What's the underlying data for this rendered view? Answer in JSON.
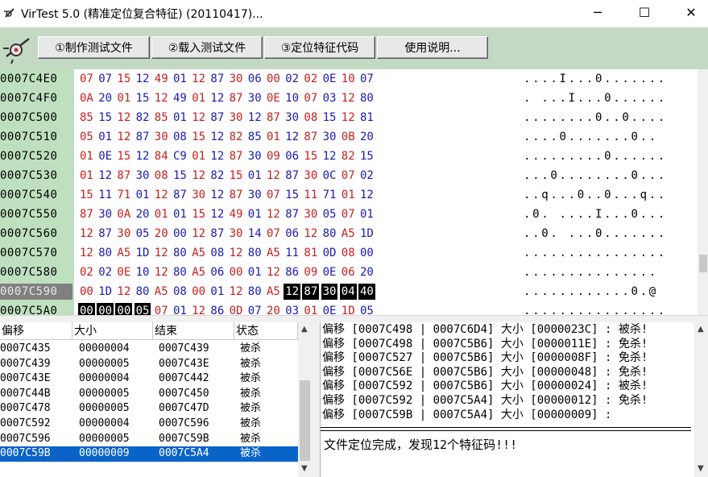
{
  "window": {
    "title": "VirTest 5.0 (精准定位复合特征) (20110417)...",
    "minimize_glyph": "─",
    "maximize_glyph": "☐",
    "close_glyph": "✕",
    "icon": "app-icon"
  },
  "toolbar": {
    "icon": "tool-icon",
    "buttons": [
      {
        "label": "①制作测试文件"
      },
      {
        "label": "②载入测试文件"
      },
      {
        "label": "③定位特征代码"
      },
      {
        "label": "使用说明..."
      }
    ]
  },
  "hex": {
    "rows": [
      {
        "addr": "0007C4E0",
        "bytes": [
          "07",
          "07",
          "15",
          "12",
          "49",
          "01",
          "12",
          "87",
          "30",
          "06",
          "00",
          "02",
          "02",
          "0E",
          "10",
          "07"
        ],
        "ascii": "....I...0......."
      },
      {
        "addr": "0007C4F0",
        "bytes": [
          "0A",
          "20",
          "01",
          "15",
          "12",
          "49",
          "01",
          "12",
          "87",
          "30",
          "0E",
          "10",
          "07",
          "03",
          "12",
          "80"
        ],
        "ascii": ". ...I...0......"
      },
      {
        "addr": "0007C500",
        "bytes": [
          "85",
          "15",
          "12",
          "82",
          "85",
          "01",
          "12",
          "87",
          "30",
          "12",
          "87",
          "30",
          "08",
          "15",
          "12",
          "81"
        ],
        "ascii": "........0..0...."
      },
      {
        "addr": "0007C510",
        "bytes": [
          "05",
          "01",
          "12",
          "87",
          "30",
          "08",
          "15",
          "12",
          "82",
          "85",
          "01",
          "12",
          "87",
          "30",
          "0B",
          "20"
        ],
        "ascii": "....0.......0.. "
      },
      {
        "addr": "0007C520",
        "bytes": [
          "01",
          "0E",
          "15",
          "12",
          "84",
          "C9",
          "01",
          "12",
          "87",
          "30",
          "09",
          "06",
          "15",
          "12",
          "82",
          "15"
        ],
        "ascii": ".........0......"
      },
      {
        "addr": "0007C530",
        "bytes": [
          "01",
          "12",
          "87",
          "30",
          "08",
          "15",
          "12",
          "82",
          "15",
          "01",
          "12",
          "87",
          "30",
          "0C",
          "07",
          "02"
        ],
        "ascii": "...0........0..."
      },
      {
        "addr": "0007C540",
        "bytes": [
          "15",
          "11",
          "71",
          "01",
          "12",
          "87",
          "30",
          "12",
          "87",
          "30",
          "07",
          "15",
          "11",
          "71",
          "01",
          "12"
        ],
        "ascii": "..q...0..0...q.."
      },
      {
        "addr": "0007C550",
        "bytes": [
          "87",
          "30",
          "0A",
          "20",
          "01",
          "01",
          "15",
          "12",
          "49",
          "01",
          "12",
          "87",
          "30",
          "05",
          "07",
          "01"
        ],
        "ascii": ".0. ....I...0..."
      },
      {
        "addr": "0007C560",
        "bytes": [
          "12",
          "87",
          "30",
          "05",
          "20",
          "00",
          "12",
          "87",
          "30",
          "14",
          "07",
          "06",
          "12",
          "80",
          "A5",
          "1D"
        ],
        "ascii": "..0. ...0......."
      },
      {
        "addr": "0007C570",
        "bytes": [
          "12",
          "80",
          "A5",
          "1D",
          "12",
          "80",
          "A5",
          "08",
          "12",
          "80",
          "A5",
          "11",
          "81",
          "0D",
          "08",
          "00"
        ],
        "ascii": "................"
      },
      {
        "addr": "0007C580",
        "bytes": [
          "02",
          "02",
          "0E",
          "10",
          "12",
          "80",
          "A5",
          "06",
          "00",
          "01",
          "12",
          "86",
          "09",
          "0E",
          "06",
          "20"
        ],
        "ascii": "............... "
      },
      {
        "addr": "0007C590",
        "bytes": [
          "00",
          "1D",
          "12",
          "80",
          "A5",
          "08",
          "00",
          "01",
          "12",
          "80",
          "A5",
          "12",
          "87",
          "30",
          "04",
          "40"
        ],
        "ascii": "............0.@",
        "selected": true
      },
      {
        "addr": "0007C5A0",
        "bytes": [
          "00",
          "00",
          "00",
          "05",
          "07",
          "01",
          "12",
          "86",
          "0D",
          "07",
          "20",
          "03",
          "01",
          "0E",
          "1D",
          "05"
        ],
        "ascii": "................"
      }
    ],
    "colors": {
      "blue": "#1a1ab4",
      "red": "#c81e1e",
      "sel_bg": "#000000",
      "sel_fg": "#ffffff",
      "addr_bg": "#bfe0bf"
    }
  },
  "grid": {
    "headers": [
      "偏移",
      "大小",
      "结束",
      "状态"
    ],
    "rows": [
      [
        "0007C435",
        "00000004",
        "0007C439",
        "被杀"
      ],
      [
        "0007C439",
        "00000005",
        "0007C43E",
        "被杀"
      ],
      [
        "0007C43E",
        "00000004",
        "0007C442",
        "被杀"
      ],
      [
        "0007C44B",
        "00000005",
        "0007C450",
        "被杀"
      ],
      [
        "0007C478",
        "00000005",
        "0007C47D",
        "被杀"
      ],
      [
        "0007C592",
        "00000004",
        "0007C596",
        "被杀"
      ],
      [
        "0007C596",
        "00000005",
        "0007C59B",
        "被杀"
      ],
      [
        "0007C59B",
        "00000009",
        "0007C5A4",
        "被杀"
      ]
    ],
    "selected_index": 7
  },
  "log": {
    "lines": [
      "偏移 [0007C498 | 0007C6D4] 大小 [0000023C] : 被杀!",
      "偏移 [0007C498 | 0007C5B6] 大小 [0000011E] : 免杀!",
      "偏移 [0007C527 | 0007C5B6] 大小 [0000008F] : 免杀!",
      "偏移 [0007C56E | 0007C5B6] 大小 [00000048] : 免杀!",
      "偏移 [0007C592 | 0007C5B6] 大小 [00000024] : 被杀!",
      "偏移 [0007C592 | 0007C5A4] 大小 [00000012] : 免杀!",
      "偏移 [0007C59B | 0007C5A4] 大小 [00000009] :"
    ],
    "result": "文件定位完成，发现12个特征码!!!"
  }
}
